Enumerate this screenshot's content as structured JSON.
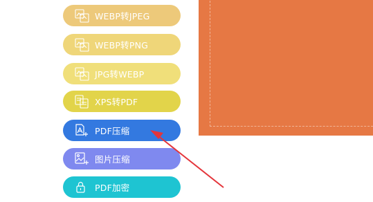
{
  "tools": [
    {
      "label": "WEBP转JPEG",
      "color": "#edc97a",
      "icon": "image-convert-icon"
    },
    {
      "label": "WEBP转PNG",
      "color": "#efd679",
      "icon": "image-convert-icon"
    },
    {
      "label": "JPG转WEBP",
      "color": "#f0df7a",
      "icon": "image-convert-icon"
    },
    {
      "label": "XPS转PDF",
      "color": "#e2d44a",
      "icon": "document-convert-icon"
    },
    {
      "label": "PDF压缩",
      "color": "#3379e0",
      "icon": "pdf-compress-icon"
    },
    {
      "label": "图片压缩",
      "color": "#7f89ef",
      "icon": "image-compress-icon"
    },
    {
      "label": "PDF加密",
      "color": "#1ec4d2",
      "icon": "lock-icon"
    }
  ],
  "drop_area": {
    "color": "#e67844"
  },
  "annotation": {
    "color": "#e4353b"
  }
}
